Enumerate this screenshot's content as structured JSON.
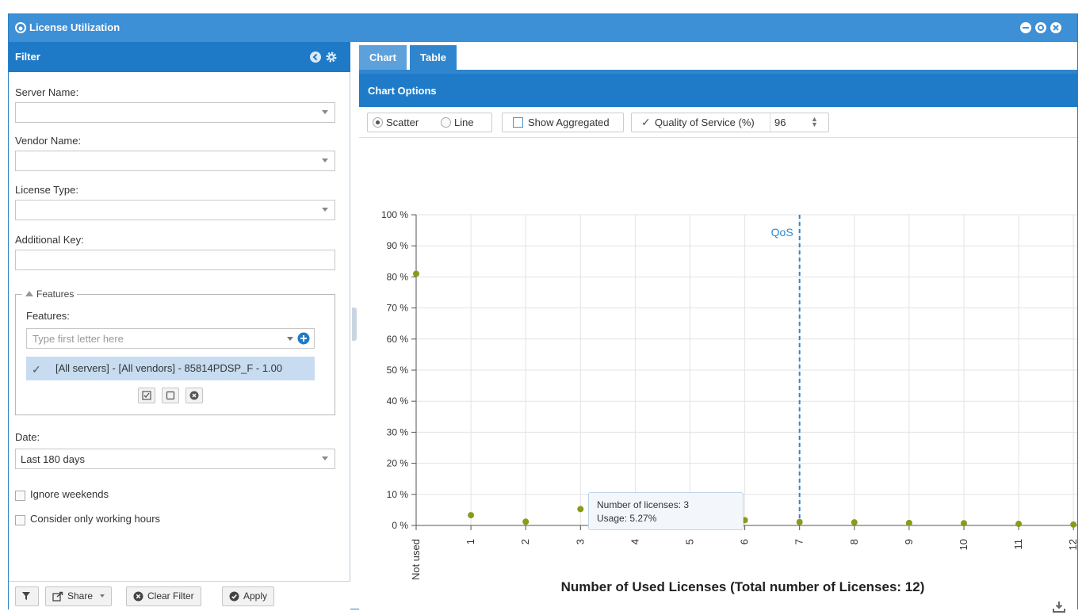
{
  "window": {
    "title": "License Utilization"
  },
  "filter": {
    "title": "Filter",
    "server_name_label": "Server Name:",
    "server_name_value": "",
    "vendor_name_label": "Vendor Name:",
    "vendor_name_value": "",
    "license_type_label": "License Type:",
    "license_type_value": "",
    "additional_key_label": "Additional Key:",
    "additional_key_value": "",
    "features_group_label": "Features",
    "features_label": "Features:",
    "features_placeholder": "Type first letter here",
    "feature_items": [
      "[All servers] - [All vendors] - 85814PDSP_F - 1.00"
    ],
    "date_label": "Date:",
    "date_value": "Last 180 days",
    "ignore_weekends_label": "Ignore weekends",
    "ignore_weekends_checked": false,
    "working_hours_label": "Consider only working hours",
    "working_hours_checked": false,
    "footer": {
      "share_label": "Share",
      "clear_label": "Clear Filter",
      "apply_label": "Apply"
    }
  },
  "tabs": [
    {
      "label": "Chart",
      "active": true
    },
    {
      "label": "Table",
      "active": false
    }
  ],
  "chart_options": {
    "title": "Chart Options",
    "scatter_label": "Scatter",
    "line_label": "Line",
    "mode": "Scatter",
    "show_aggregated_label": "Show Aggregated",
    "show_aggregated_checked": false,
    "qos_label": "Quality of Service (%)",
    "qos_checked": true,
    "qos_value": "96"
  },
  "tooltip": {
    "line1": "Number of licenses: 3",
    "line2": "Usage: 5.27%"
  },
  "colors": {
    "header_blue": "#1f7bc8",
    "titlebar_blue": "#3d8fd6",
    "point_color": "#8a9a1b",
    "qos_line": "#2f86cf"
  },
  "chart_data": {
    "type": "scatter",
    "categories": [
      "Not used",
      "1",
      "2",
      "3",
      "4",
      "5",
      "6",
      "7",
      "8",
      "9",
      "10",
      "11",
      "12"
    ],
    "series": [
      {
        "values": [
          81,
          3.3,
          1.2,
          5.27,
          1.9,
          3.0,
          1.7,
          1.1,
          1.0,
          0.8,
          0.7,
          0.5,
          0.3
        ]
      }
    ],
    "y_ticks": [
      "0 %",
      "10 %",
      "20 %",
      "30 %",
      "40 %",
      "50 %",
      "60 %",
      "70 %",
      "80 %",
      "90 %",
      "100 %"
    ],
    "ylim": [
      0,
      100
    ],
    "xlabel": "Number of Used Licenses (Total number of Licenses: 12)",
    "qos_marker": {
      "label": "QoS",
      "category": "7"
    },
    "grid": true,
    "legend": "none"
  }
}
